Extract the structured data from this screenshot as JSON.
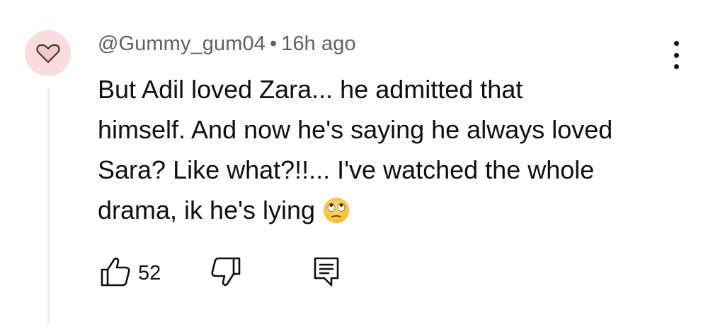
{
  "comment": {
    "author": "@Gummy_gum04",
    "separator": "•",
    "time": "16h ago",
    "text_lines": [
      "But Adil loved Zara... he admitted that",
      "himself. And now he's saying he always loved",
      "Sara? Like what?!!... I've watched the whole",
      "drama, ik he's lying"
    ],
    "emoji": "face-with-rolling-eyes",
    "like_count": "52"
  },
  "icons": {
    "avatar": "heart-icon",
    "more": "more-vert-icon",
    "like": "thumbs-up-icon",
    "dislike": "thumbs-down-icon",
    "reply": "reply-comment-icon"
  },
  "colors": {
    "avatar_bg": "#f9dcdc",
    "meta_text": "#606060",
    "text": "#0f0f0f"
  }
}
